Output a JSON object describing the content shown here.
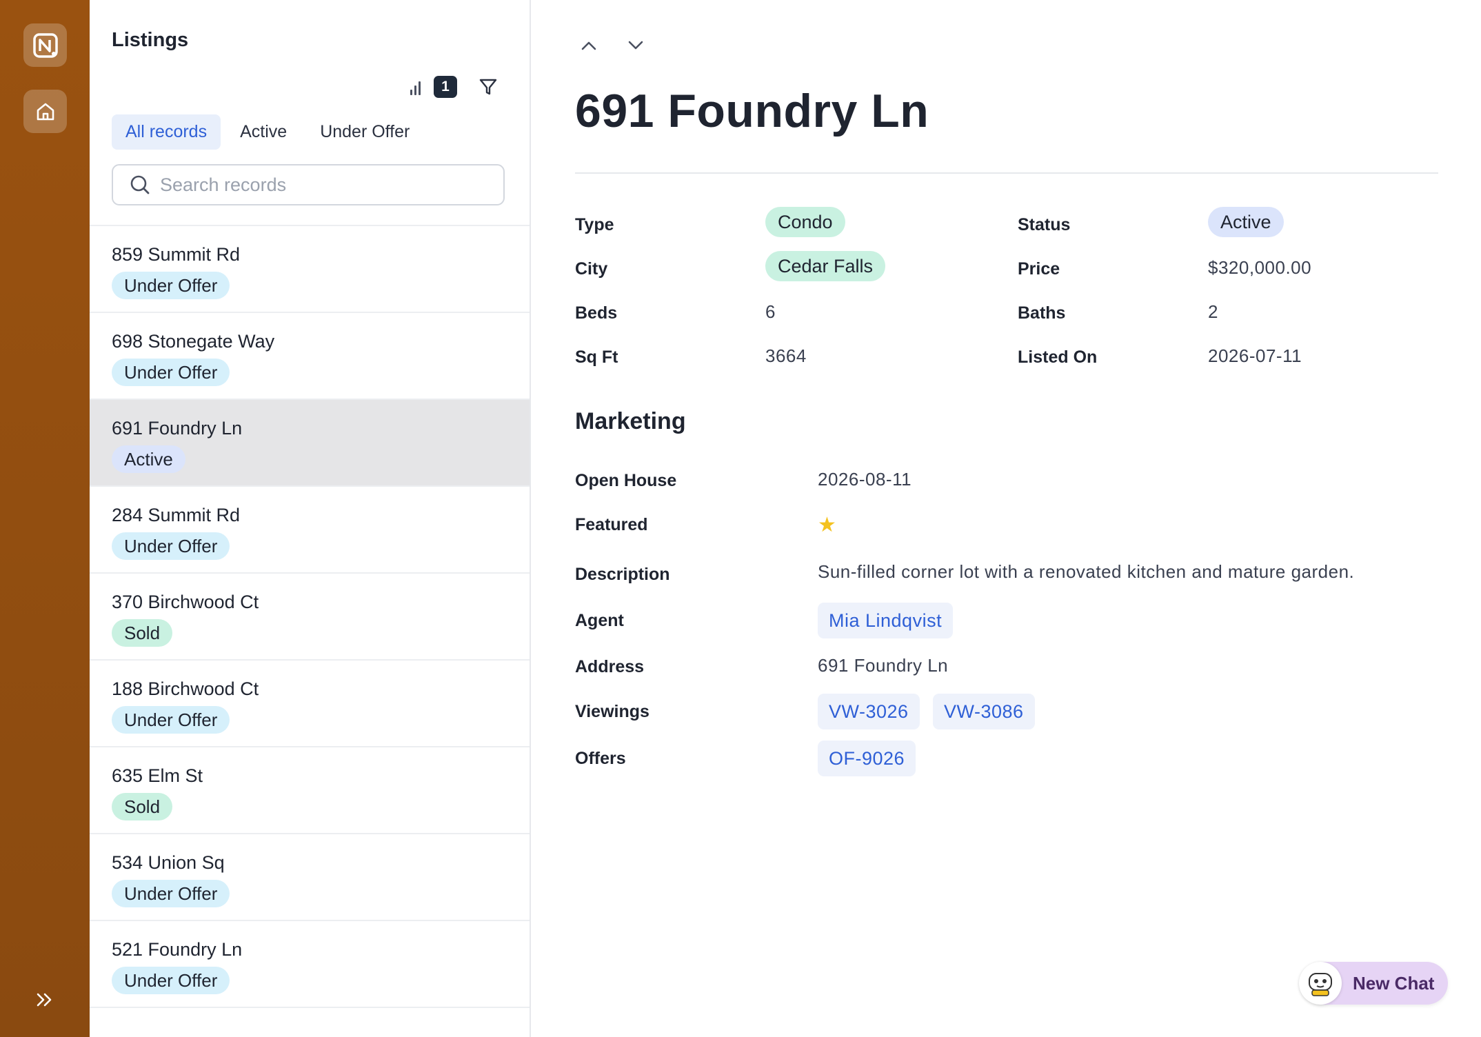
{
  "rail": {
    "logo_icon": "app-logo-icon",
    "home_icon": "home-icon",
    "expand_icon": "chevrons-right-icon"
  },
  "list": {
    "title": "Listings",
    "count_badge": "1",
    "tabs": [
      {
        "label": "All records"
      },
      {
        "label": "Active"
      },
      {
        "label": "Under Offer"
      }
    ],
    "search": {
      "placeholder": "Search records"
    },
    "records": [
      {
        "title": "859 Summit Rd",
        "status": "Under Offer"
      },
      {
        "title": "698 Stonegate Way",
        "status": "Under Offer"
      },
      {
        "title": "691 Foundry Ln",
        "status": "Active"
      },
      {
        "title": "284 Summit Rd",
        "status": "Under Offer"
      },
      {
        "title": "370 Birchwood Ct",
        "status": "Sold"
      },
      {
        "title": "188 Birchwood Ct",
        "status": "Under Offer"
      },
      {
        "title": "635 Elm St",
        "status": "Sold"
      },
      {
        "title": "534 Union Sq",
        "status": "Under Offer"
      },
      {
        "title": "521 Foundry Ln",
        "status": "Under Offer"
      }
    ]
  },
  "detail": {
    "title": "691 Foundry Ln",
    "fields": {
      "type_label": "Type",
      "type_value": "Condo",
      "status_label": "Status",
      "status_value": "Active",
      "city_label": "City",
      "city_value": "Cedar Falls",
      "price_label": "Price",
      "price_value": "$320,000.00",
      "beds_label": "Beds",
      "beds_value": "6",
      "baths_label": "Baths",
      "baths_value": "2",
      "sqft_label": "Sq Ft",
      "sqft_value": "3664",
      "listed_label": "Listed On",
      "listed_value": "2026-07-11"
    },
    "marketing": {
      "title": "Marketing",
      "open_house_label": "Open House",
      "open_house_value": "2026-08-11",
      "featured_label": "Featured",
      "featured_icon": "star-icon",
      "description_label": "Description",
      "description_value": "Sun-filled corner lot with a renovated kitchen and mature garden.",
      "agent_label": "Agent",
      "agent_value": "Mia Lindqvist",
      "address_label": "Address",
      "address_value": "691 Foundry Ln",
      "viewings_label": "Viewings",
      "viewings": [
        "VW-3026",
        "VW-3086"
      ],
      "offers_label": "Offers",
      "offers": [
        "OF-9026"
      ]
    }
  },
  "chat": {
    "label": "New Chat"
  },
  "colors": {
    "rail": "#8a4a10",
    "accent": "#2e5fd6",
    "pill_under_offer": "#d6f0fb",
    "pill_active": "#dbe4fb",
    "pill_sold": "#c9f1e1",
    "chat_button": "#e6d4f5"
  }
}
